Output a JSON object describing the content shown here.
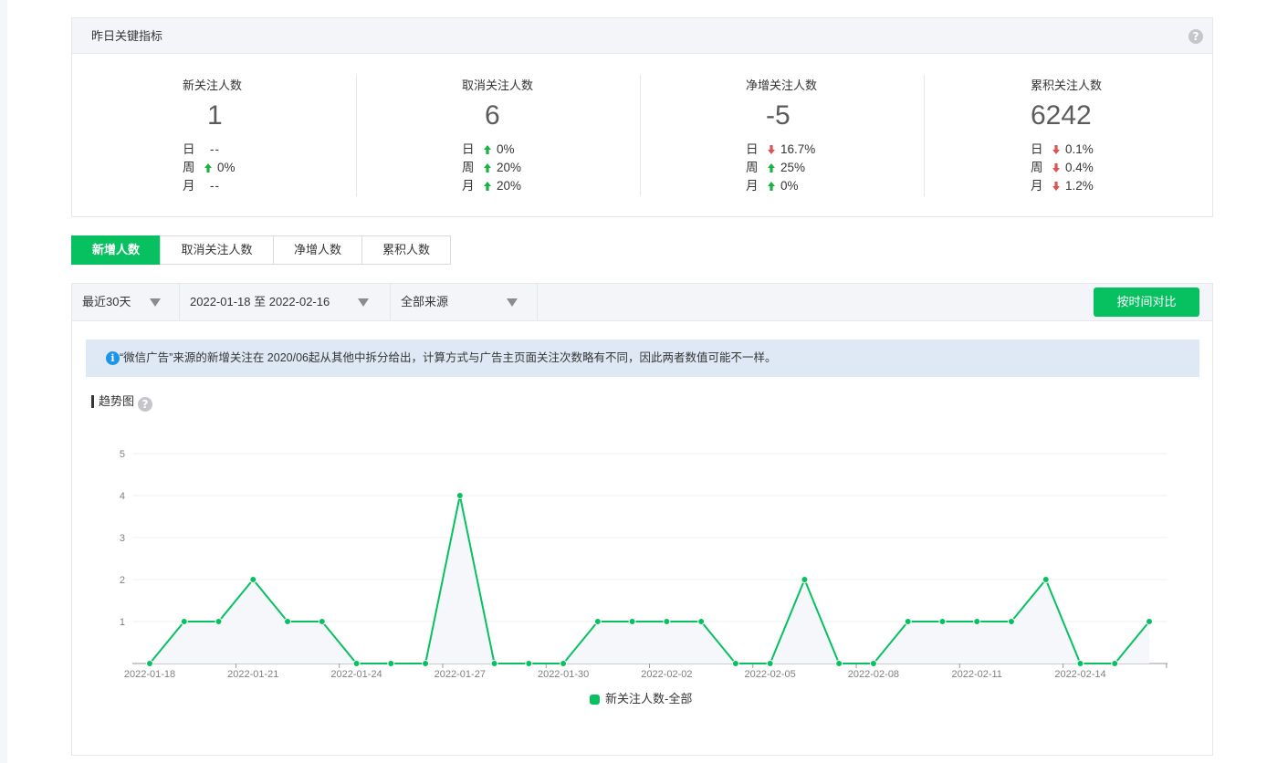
{
  "kpi": {
    "header": "昨日关键指标",
    "help_icon": "help-icon",
    "labels": {
      "day": "日",
      "week": "周",
      "month": "月"
    },
    "cards": [
      {
        "title": "新关注人数",
        "value": "1",
        "stats": [
          {
            "period": "日",
            "dir": "none",
            "value": "--"
          },
          {
            "period": "周",
            "dir": "up",
            "value": "0%"
          },
          {
            "period": "月",
            "dir": "none",
            "value": "--"
          }
        ]
      },
      {
        "title": "取消关注人数",
        "value": "6",
        "stats": [
          {
            "period": "日",
            "dir": "up",
            "value": "0%"
          },
          {
            "period": "周",
            "dir": "up",
            "value": "20%"
          },
          {
            "period": "月",
            "dir": "up",
            "value": "20%"
          }
        ]
      },
      {
        "title": "净增关注人数",
        "value": "-5",
        "stats": [
          {
            "period": "日",
            "dir": "down",
            "value": "16.7%"
          },
          {
            "period": "周",
            "dir": "up",
            "value": "25%"
          },
          {
            "period": "月",
            "dir": "up",
            "value": "0%"
          }
        ]
      },
      {
        "title": "累积关注人数",
        "value": "6242",
        "stats": [
          {
            "period": "日",
            "dir": "down",
            "value": "0.1%"
          },
          {
            "period": "周",
            "dir": "down",
            "value": "0.4%"
          },
          {
            "period": "月",
            "dir": "down",
            "value": "1.2%"
          }
        ]
      }
    ]
  },
  "tabs": [
    {
      "label": "新增人数",
      "active": true
    },
    {
      "label": "取消关注人数",
      "active": false
    },
    {
      "label": "净增人数",
      "active": false
    },
    {
      "label": "累积人数",
      "active": false
    }
  ],
  "filters": {
    "range": "最近30天",
    "dates": "2022-01-18 至 2022-02-16",
    "source": "全部来源",
    "compare_button": "按时间对比"
  },
  "notice": {
    "icon": "info-icon",
    "text": "“微信广告”来源的新增关注在 2020/06起从其他中拆分给出，计算方式与广告主页面关注次数略有不同，因此两者数值可能不一样。"
  },
  "trend": {
    "title": "趋势图"
  },
  "colors": {
    "accent": "#07c160",
    "up": "#17b344",
    "down": "#e05252",
    "info": "#1c95e8"
  },
  "chart_data": {
    "type": "line",
    "title": "",
    "xlabel": "",
    "ylabel": "",
    "ylim": [
      0,
      5
    ],
    "yticks": [
      1,
      2,
      3,
      4,
      5
    ],
    "grid": true,
    "legend_position": "bottom",
    "x": [
      "2022-01-18",
      "2022-01-19",
      "2022-01-20",
      "2022-01-21",
      "2022-01-22",
      "2022-01-23",
      "2022-01-24",
      "2022-01-25",
      "2022-01-26",
      "2022-01-27",
      "2022-01-28",
      "2022-01-29",
      "2022-01-30",
      "2022-01-31",
      "2022-02-01",
      "2022-02-02",
      "2022-02-03",
      "2022-02-04",
      "2022-02-05",
      "2022-02-06",
      "2022-02-07",
      "2022-02-08",
      "2022-02-09",
      "2022-02-10",
      "2022-02-11",
      "2022-02-12",
      "2022-02-13",
      "2022-02-14",
      "2022-02-15",
      "2022-02-16"
    ],
    "xtick_labels": [
      "2022-01-18",
      "2022-01-21",
      "2022-01-24",
      "2022-01-27",
      "2022-01-30",
      "2022-02-02",
      "2022-02-05",
      "2022-02-08",
      "2022-02-11",
      "2022-02-14"
    ],
    "series": [
      {
        "name": "新关注人数-全部",
        "values": [
          0,
          1,
          1,
          2,
          1,
          1,
          0,
          0,
          0,
          4,
          0,
          0,
          0,
          1,
          1,
          1,
          1,
          0,
          0,
          2,
          0,
          0,
          1,
          1,
          1,
          1,
          2,
          0,
          0,
          1
        ]
      }
    ]
  }
}
